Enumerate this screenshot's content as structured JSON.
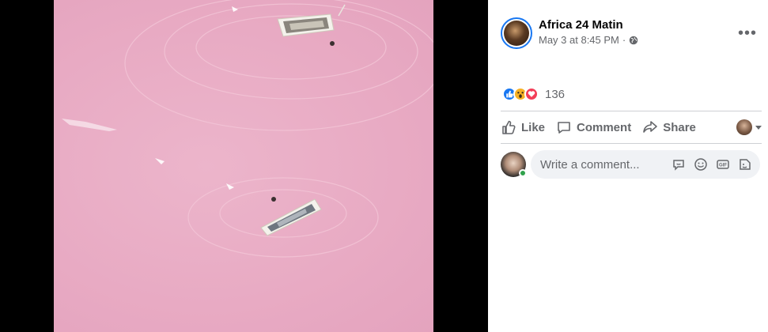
{
  "post": {
    "page_name": "Africa 24 Matin",
    "timestamp": "May 3 at 8:45 PM",
    "separator": "·",
    "more_icon": "more-horizontal-icon",
    "privacy_icon": "globe-icon"
  },
  "reactions": {
    "types": [
      "like",
      "wow",
      "love"
    ],
    "count": "136"
  },
  "actions": {
    "like_label": "Like",
    "comment_label": "Comment",
    "share_label": "Share"
  },
  "composer": {
    "placeholder": "Write a comment...",
    "tools": [
      "sticker-icon",
      "emoji-icon",
      "gif-icon",
      "camera-sticker-icon"
    ]
  },
  "photo": {
    "description_colors": {
      "water": "#e8aac3",
      "boat_hull": "#f2f0ea"
    }
  }
}
